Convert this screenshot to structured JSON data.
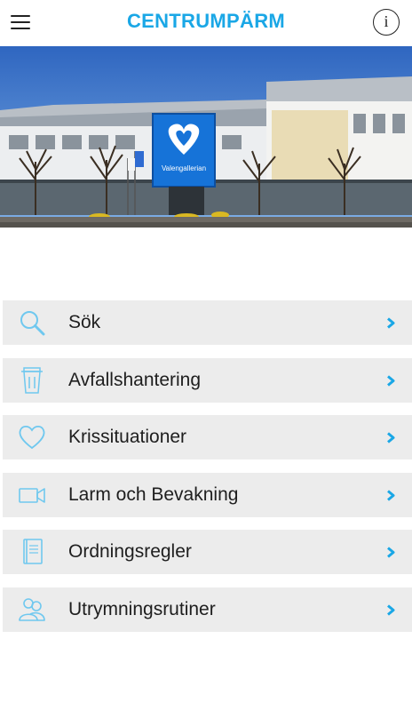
{
  "header": {
    "title": "CENTRUMPÄRM",
    "menu_icon": "hamburger-icon",
    "info_icon": "info-icon",
    "info_glyph": "i"
  },
  "hero": {
    "sign_text": "Valengallerian"
  },
  "colors": {
    "accent": "#1aa7e6",
    "item_background": "#ececec",
    "icon_color": "#6fc8ef"
  },
  "menu": {
    "items": [
      {
        "label": "Sök",
        "icon": "search-icon"
      },
      {
        "label": "Avfallshantering",
        "icon": "trash-icon"
      },
      {
        "label": "Krissituationer",
        "icon": "heart-icon"
      },
      {
        "label": "Larm och Bevakning",
        "icon": "video-camera-icon"
      },
      {
        "label": "Ordningsregler",
        "icon": "book-icon"
      },
      {
        "label": "Utrymningsrutiner",
        "icon": "people-icon"
      }
    ]
  }
}
